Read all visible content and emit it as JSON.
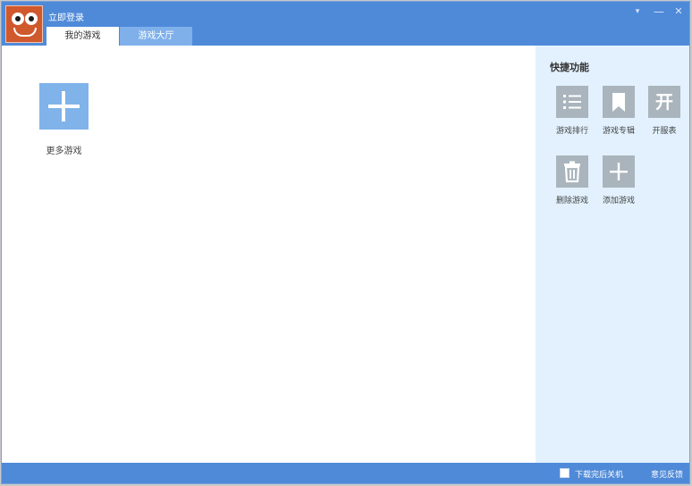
{
  "header": {
    "login_link": "立即登录",
    "tabs": [
      {
        "label": "我的游戏",
        "active": true
      },
      {
        "label": "游戏大厅",
        "active": false
      }
    ],
    "controls": {
      "menu": "▾",
      "minimize": "—",
      "close": "✕"
    },
    "avatar_icon": "smiley-face-icon"
  },
  "main": {
    "more_games_label": "更多游戏",
    "tile_icon": "plus-icon"
  },
  "sidebar": {
    "title": "快捷功能",
    "items": [
      {
        "label": "游戏排行",
        "icon": "list-icon"
      },
      {
        "label": "游戏专辑",
        "icon": "bookmark-icon",
        "glyph": ""
      },
      {
        "label": "开服表",
        "icon": "kai-character-icon",
        "glyph": "开"
      },
      {
        "label": "删除游戏",
        "icon": "trash-icon"
      },
      {
        "label": "添加游戏",
        "icon": "plus-icon"
      }
    ]
  },
  "statusbar": {
    "shutdown_checkbox_label": "下载完后关机",
    "feedback_link": "意见反馈"
  },
  "colors": {
    "accent": "#4f8ad9",
    "sidebar_bg": "#e2f1fd",
    "tile": "#7fb3ea",
    "icon_gray": "#aab4bc"
  }
}
